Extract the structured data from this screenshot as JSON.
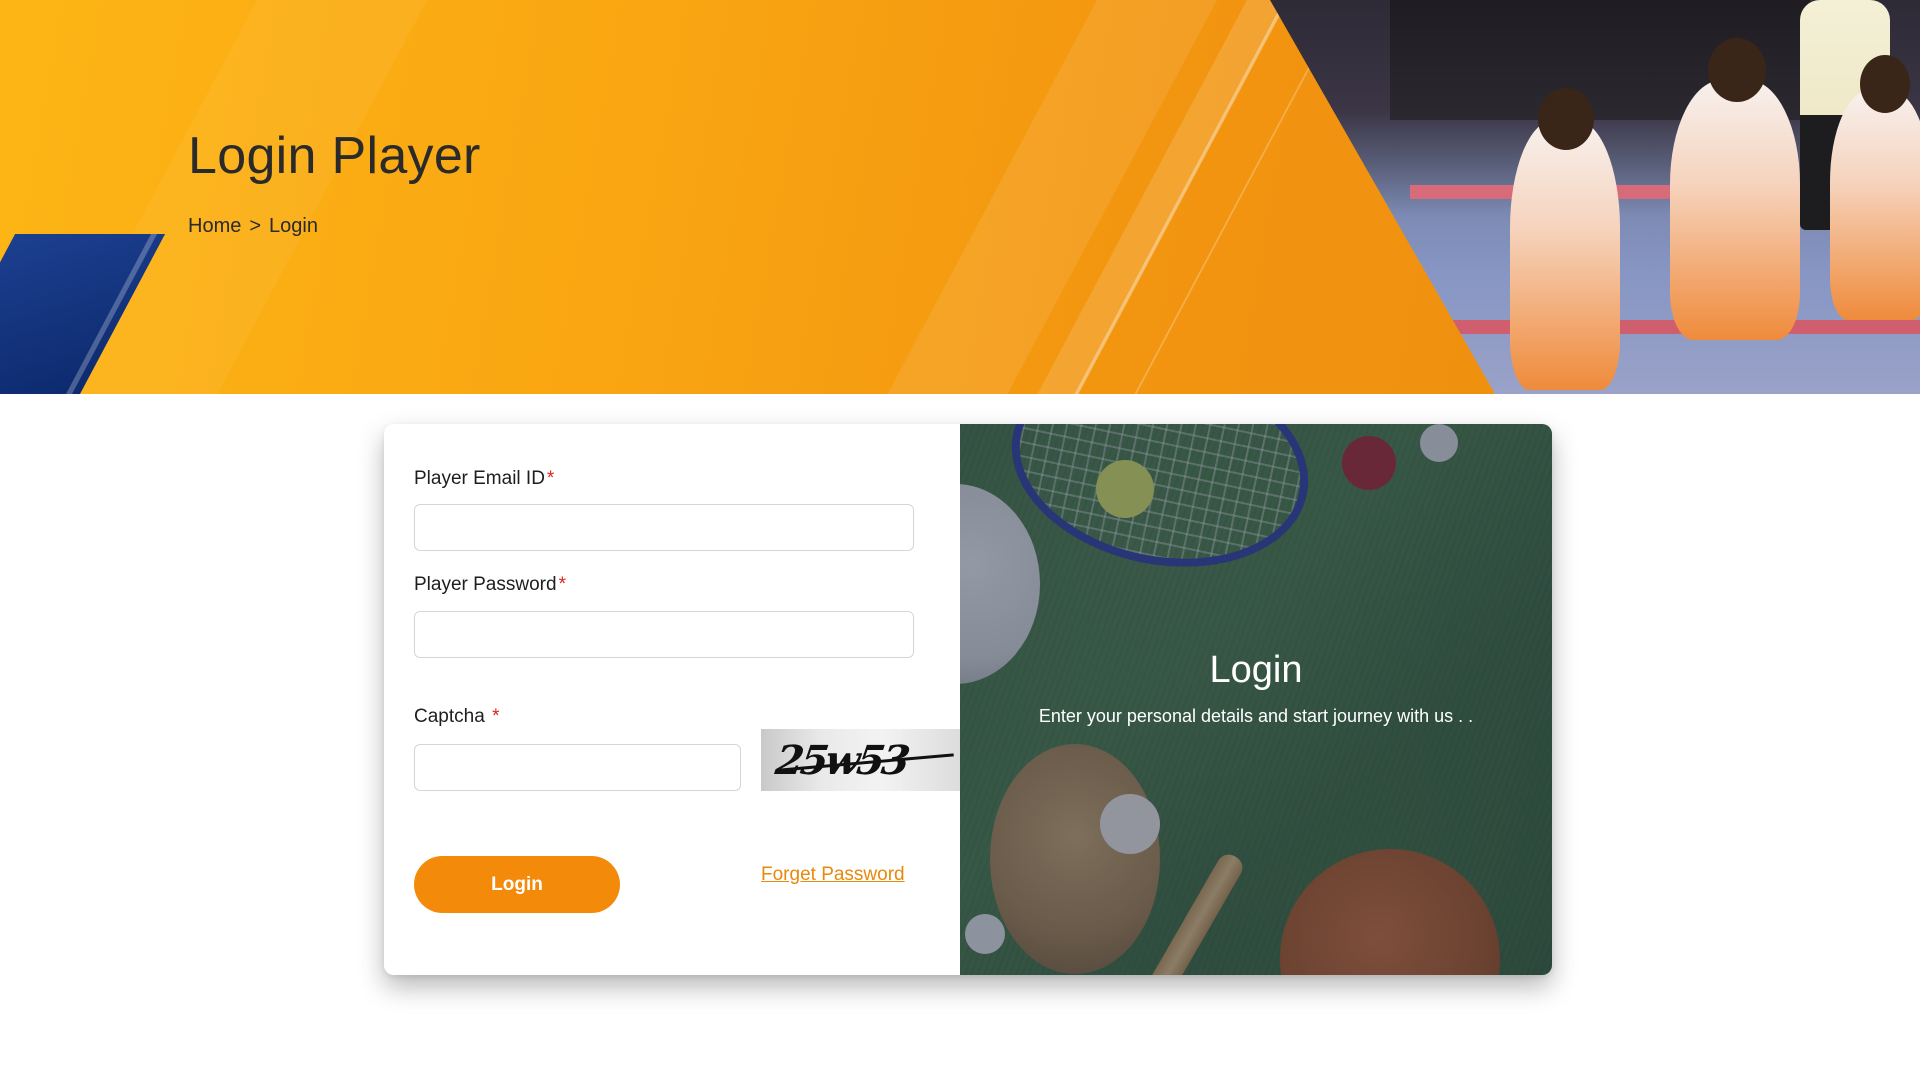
{
  "hero": {
    "title": "Login Player",
    "breadcrumb": {
      "home": "Home",
      "separator": ">",
      "current": "Login"
    }
  },
  "form": {
    "email_label": "Player Email ID",
    "email_value": "",
    "password_label": "Player Password",
    "password_value": "",
    "captcha_label": "Captcha",
    "captcha_value": "",
    "captcha_code": "25w53",
    "required_mark": "*",
    "login_button": "Login",
    "forget_link": "Forget Password"
  },
  "panel": {
    "title": "Login",
    "subtitle": "Enter your personal details and start journey with us . ."
  },
  "colors": {
    "accent": "#f48a0a",
    "banner": "#f9a512",
    "required": "#d9261c",
    "link": "#e8890c"
  },
  "icons": {
    "banner_photo": "sports-players-photo",
    "panel_photo": "sports-equipment-photo"
  }
}
